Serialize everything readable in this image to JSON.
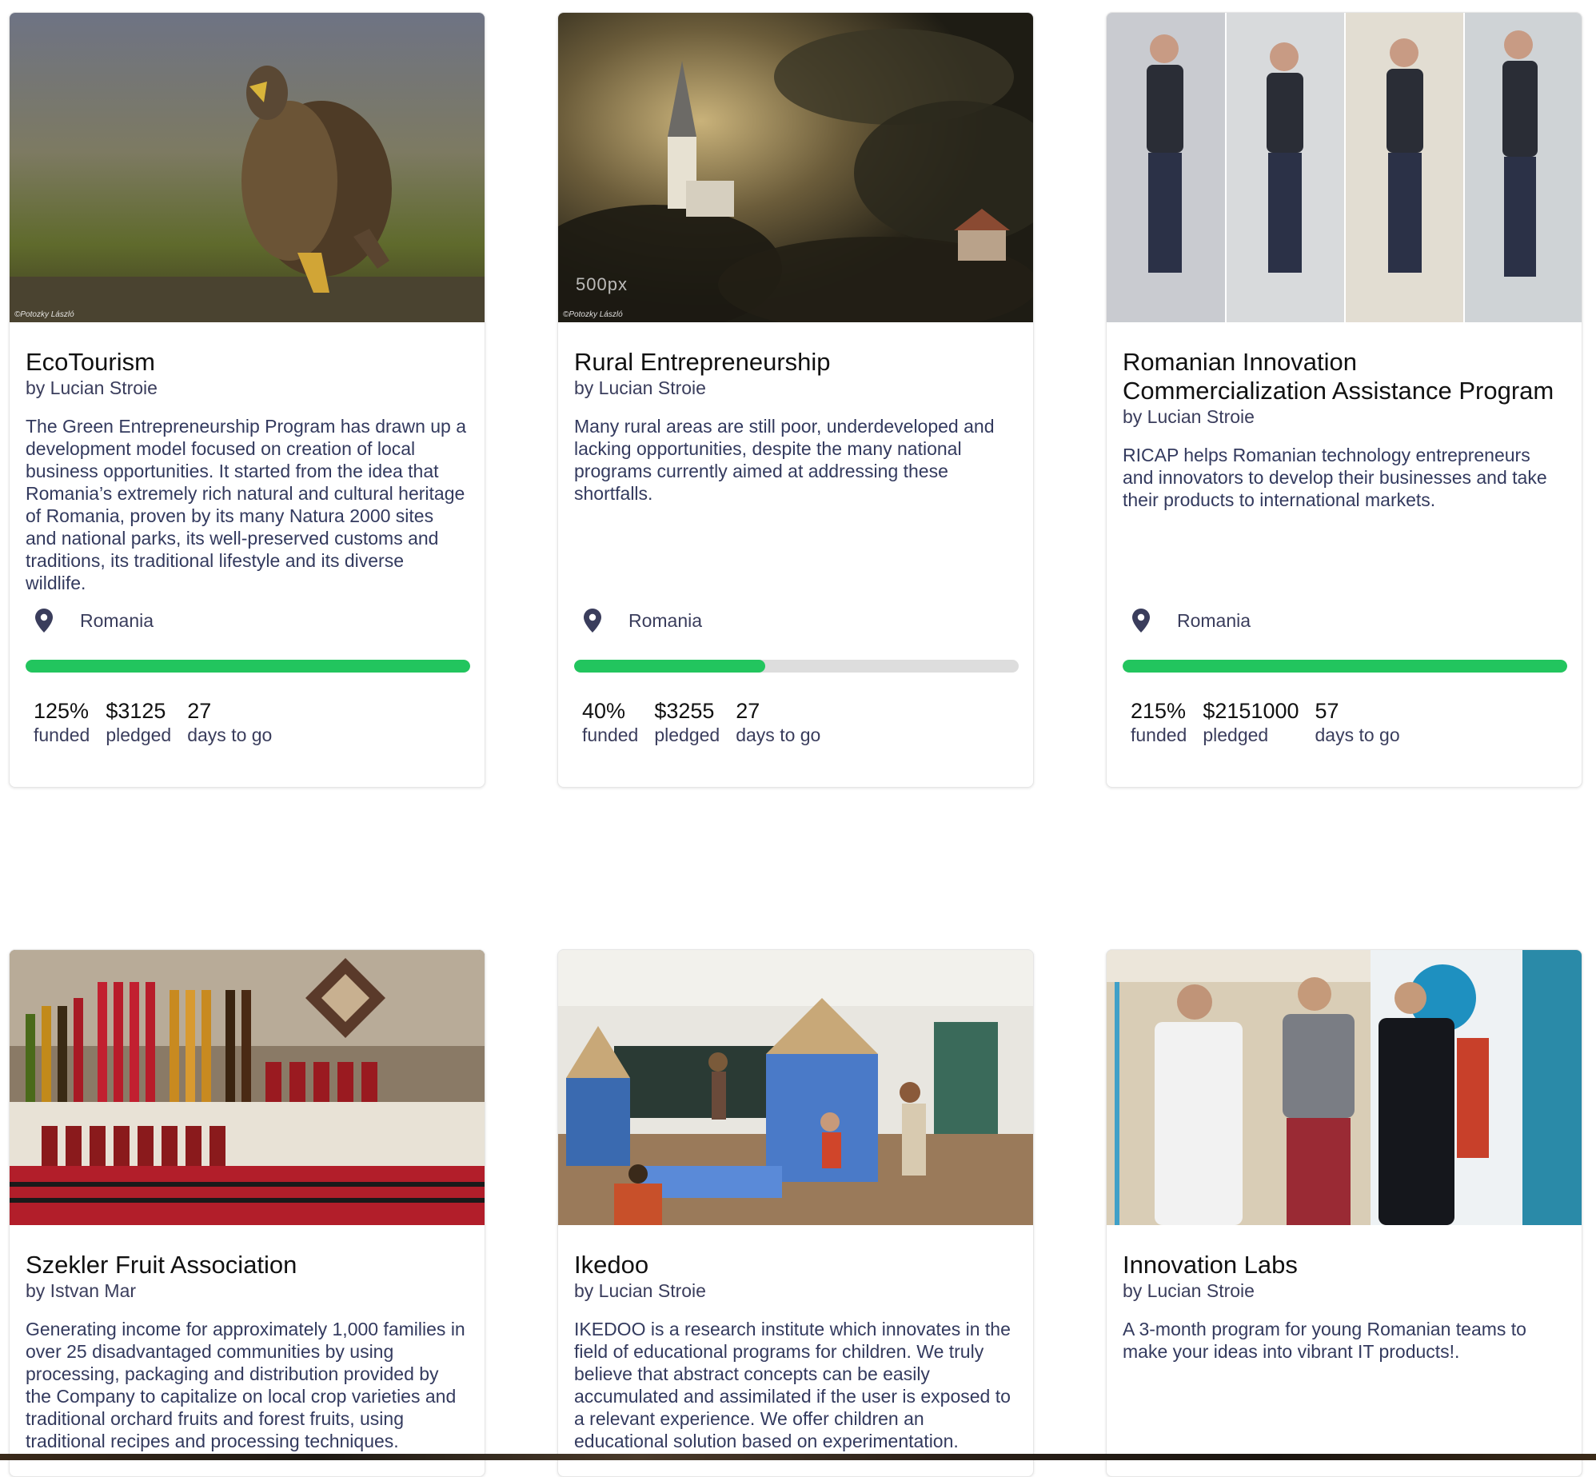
{
  "cards": [
    {
      "title": "EcoTourism",
      "author": "by Lucian Stroie",
      "description": "The Green Entrepreneurship Program has drawn up a development model focused on creation of local business opportunities. It started from the idea that Romania’s extremely rich natural and cultural heritage of Romania, proven by its many Natura 2000 sites and national parks, its well-preserved customs and traditions, its traditional lifestyle and its diverse wildlife.",
      "location": "Romania",
      "photo_credit": "©Potozky László",
      "progress": 1.0,
      "funded_pct": "125%",
      "funded_label": "funded",
      "pledged": "$3125",
      "pledged_label": "pledged",
      "days": "27",
      "days_label": "days to go"
    },
    {
      "title": "Rural Entrepreneurship",
      "author": "by Lucian Stroie",
      "description": "Many rural areas are still poor, underdeveloped and lacking opportunities, despite the many national programs currently aimed at addressing these shortfalls.",
      "location": "Romania",
      "photo_credit": "©Potozky László",
      "watermark": "500px",
      "progress": 0.4,
      "funded_pct": "40%",
      "funded_label": "funded",
      "pledged": "$3255",
      "pledged_label": "pledged",
      "days": "27",
      "days_label": "days to go"
    },
    {
      "title": "Romanian Innovation Commercialization Assistance Program",
      "author": "by Lucian Stroie",
      "description": "RICAP helps Romanian technology entrepreneurs and innovators to develop their businesses and take their products to international markets.",
      "location": "Romania",
      "progress": 1.0,
      "funded_pct": "215%",
      "funded_label": "funded",
      "pledged": "$2151000",
      "pledged_label": "pledged",
      "days": "57",
      "days_label": "days to go"
    },
    {
      "title": "Szekler Fruit Association",
      "author": "by Istvan Mar",
      "description": "Generating income for approximately 1,000 families in over 25 disadvantaged communities by using processing, packaging and distribution provided by the Company to capitalize on local crop varieties and traditional orchard fruits and forest fruits, using traditional recipes and processing techniques."
    },
    {
      "title": "Ikedoo",
      "author": "by Lucian Stroie",
      "description": "IKEDOO is a research institute which innovates in the field of educational programs for children. We truly believe that abstract concepts can be easily accumulated and assimilated if the user is exposed to a relevant experience. We offer children an educational solution based on experimentation."
    },
    {
      "title": "Innovation Labs",
      "author": "by Lucian Stroie",
      "description": "A 3-month program for young Romanian teams to make your ideas into vibrant IT products!."
    }
  ],
  "icons": {
    "location": "map-pin-icon"
  },
  "colors": {
    "progress": "#22c55e",
    "track": "#dddddd",
    "text": "#333a5e"
  }
}
